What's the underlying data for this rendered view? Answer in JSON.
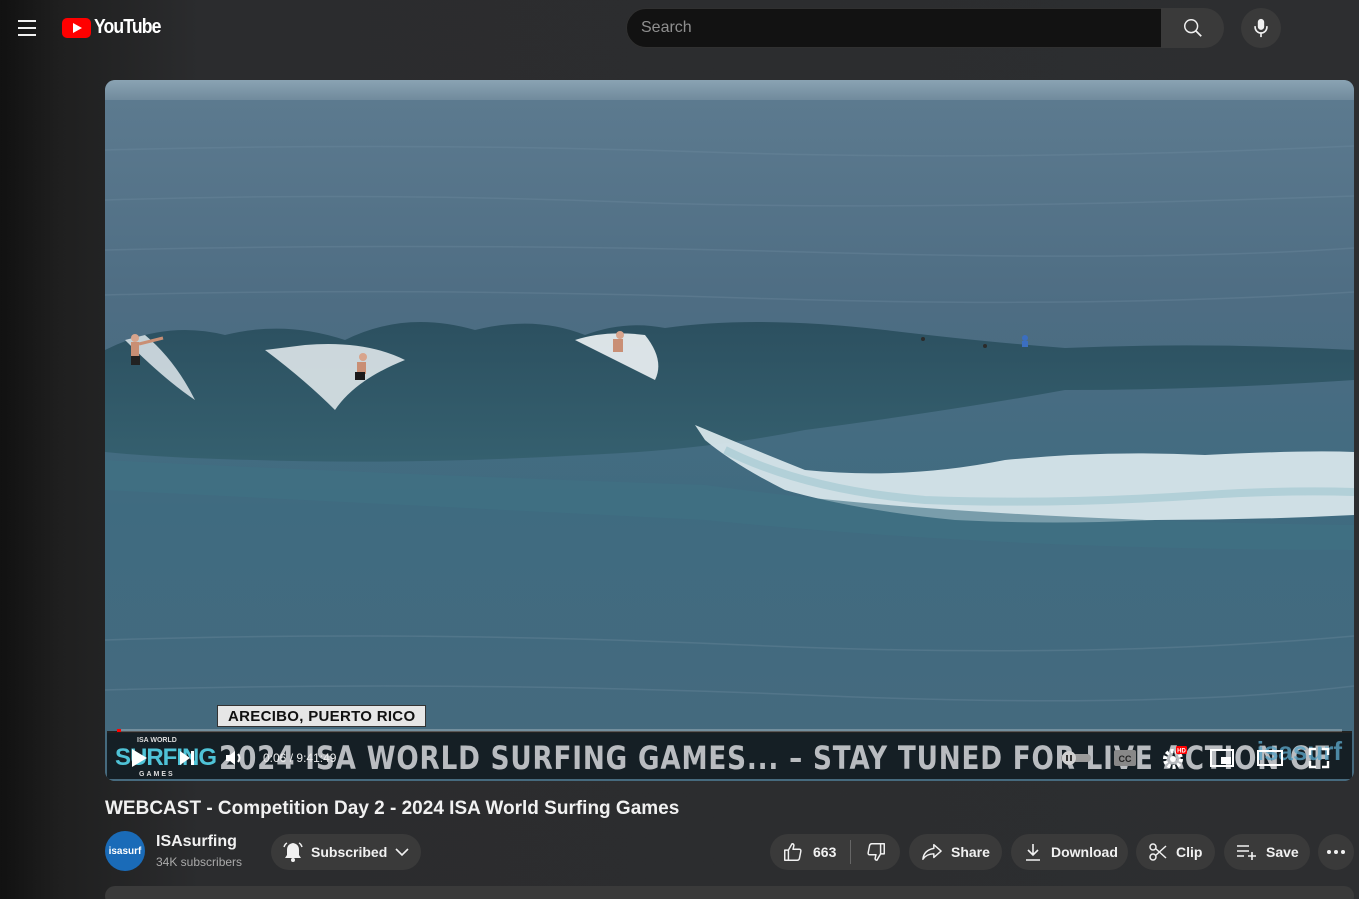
{
  "app": {
    "logo_text": "YouTube"
  },
  "search": {
    "placeholder": "Search"
  },
  "icons": {
    "menu": "menu-icon",
    "search": "search-icon",
    "mic": "mic-icon",
    "play": "play-icon",
    "next": "next-icon",
    "volume": "volume-icon",
    "autoplay": "autoplay-toggle-icon",
    "cc": "cc-icon",
    "settings": "gear-icon",
    "miniplayer": "miniplayer-icon",
    "theater": "theater-icon",
    "fullscreen": "fullscreen-icon",
    "bell": "bell-icon",
    "chevron": "chevron-down-icon",
    "like": "thumbs-up-icon",
    "dislike": "thumbs-down-icon",
    "share": "share-icon",
    "download": "download-icon",
    "clip": "scissors-icon",
    "save": "playlist-add-icon",
    "more": "more-horiz-icon"
  },
  "player": {
    "location_caption": "ARECIBO, PUERTO RICO",
    "ticker_brand_top": "ISA WORLD",
    "ticker_brand_mid": "SURFING",
    "ticker_brand_bot": "GAMES",
    "ticker_text": "2024 ISA WORLD SURFING GAMES...  –  STAY TUNED FOR LIVE ACTION OF",
    "ticker_logo": "isasurf",
    "time_current": "0:06",
    "time_separator": "/",
    "time_total": "9:41:49",
    "hd_badge": "HD",
    "progress": 0.0002
  },
  "video": {
    "title": "WEBCAST - Competition Day 2 - 2024 ISA World Surfing Games"
  },
  "channel": {
    "avatar_text": "isasurf",
    "name": "ISAsurfing",
    "subscribers": "34K subscribers",
    "subscribe_label": "Subscribed"
  },
  "actions": {
    "likes": "663",
    "share": "Share",
    "download": "Download",
    "clip": "Clip",
    "save": "Save"
  },
  "colors": {
    "accent": "#ff0000",
    "background": "#0f0f0f",
    "chip": "#3a3a3a"
  }
}
